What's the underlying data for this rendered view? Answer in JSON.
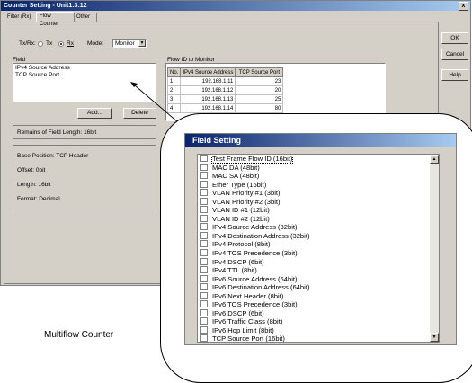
{
  "window": {
    "title": "Counter Setting - Unit1:3:12",
    "close": "x",
    "tabs": [
      "Filter (Rx)",
      "Flow Counter",
      "Other"
    ],
    "active_tab": "Flow Counter"
  },
  "txrx": {
    "label": "Tx/Rx:",
    "options": [
      "Tx",
      "Rx"
    ],
    "selected": "Rx",
    "mode_label": "Mode:",
    "mode_value": "Monitor"
  },
  "buttons": {
    "ok": "OK",
    "cancel": "Cancel",
    "help": "Help",
    "add": "Add...",
    "delete": "Delete"
  },
  "field": {
    "label": "Field",
    "items": [
      "IPv4 Source Address",
      "TCP Source Port"
    ],
    "remains": "Remains of Field Length: 16bit",
    "info": [
      "Base Position: TCP Header",
      "Offset: 0bit",
      "Length: 16bit",
      "Format: Decimal"
    ]
  },
  "flow": {
    "label": "Flow ID to Monitor",
    "columns": [
      "No.",
      "IPv4 Source Address",
      "TCP Source Port"
    ],
    "rows": [
      [
        "1",
        "192.168.1.11",
        "23"
      ],
      [
        "2",
        "192.168.1.12",
        "20"
      ],
      [
        "3",
        "192.168.1.13",
        "25"
      ],
      [
        "4",
        "192.168.1.14",
        "80"
      ]
    ]
  },
  "dialog": {
    "title": "Field Setting",
    "items": [
      "Test Frame Flow ID (16bit)",
      "MAC DA (48bit)",
      "MAC SA (48bit)",
      "Ether Type (16bit)",
      "VLAN Priority #1 (3bit)",
      "VLAN Priority #2 (3bit)",
      "VLAN ID #1 (12bit)",
      "VLAN ID #2 (12bit)",
      "IPv4 Source Address (32bit)",
      "IPv4 Destination Address (32bit)",
      "IPv4 Protocol (8bit)",
      "IPv4 TOS Precedence (3bit)",
      "IPv4 DSCP (6bit)",
      "IPv4 TTL (8bit)",
      "IPv6 Source Address (64bit)",
      "IPv6 Destination Address (64bit)",
      "IPv6 Next Header (8bit)",
      "IPv6 TOS Precedence (3bit)",
      "IPv6 DSCP (6bit)",
      "IPv6 Traffic Class (8bit)",
      "IPv6 Hop Limit (8bit)",
      "TCP Source Port (16bit)"
    ]
  },
  "caption": "Multiflow Counter",
  "icons": {
    "dropdown": "chevron-down-icon",
    "scroll_up": "scroll-up-icon",
    "scroll_down": "scroll-down-icon"
  },
  "colors": {
    "titlebar_start": "#0a246a",
    "titlebar_end": "#a6caf0",
    "face": "#d4d0c8"
  }
}
